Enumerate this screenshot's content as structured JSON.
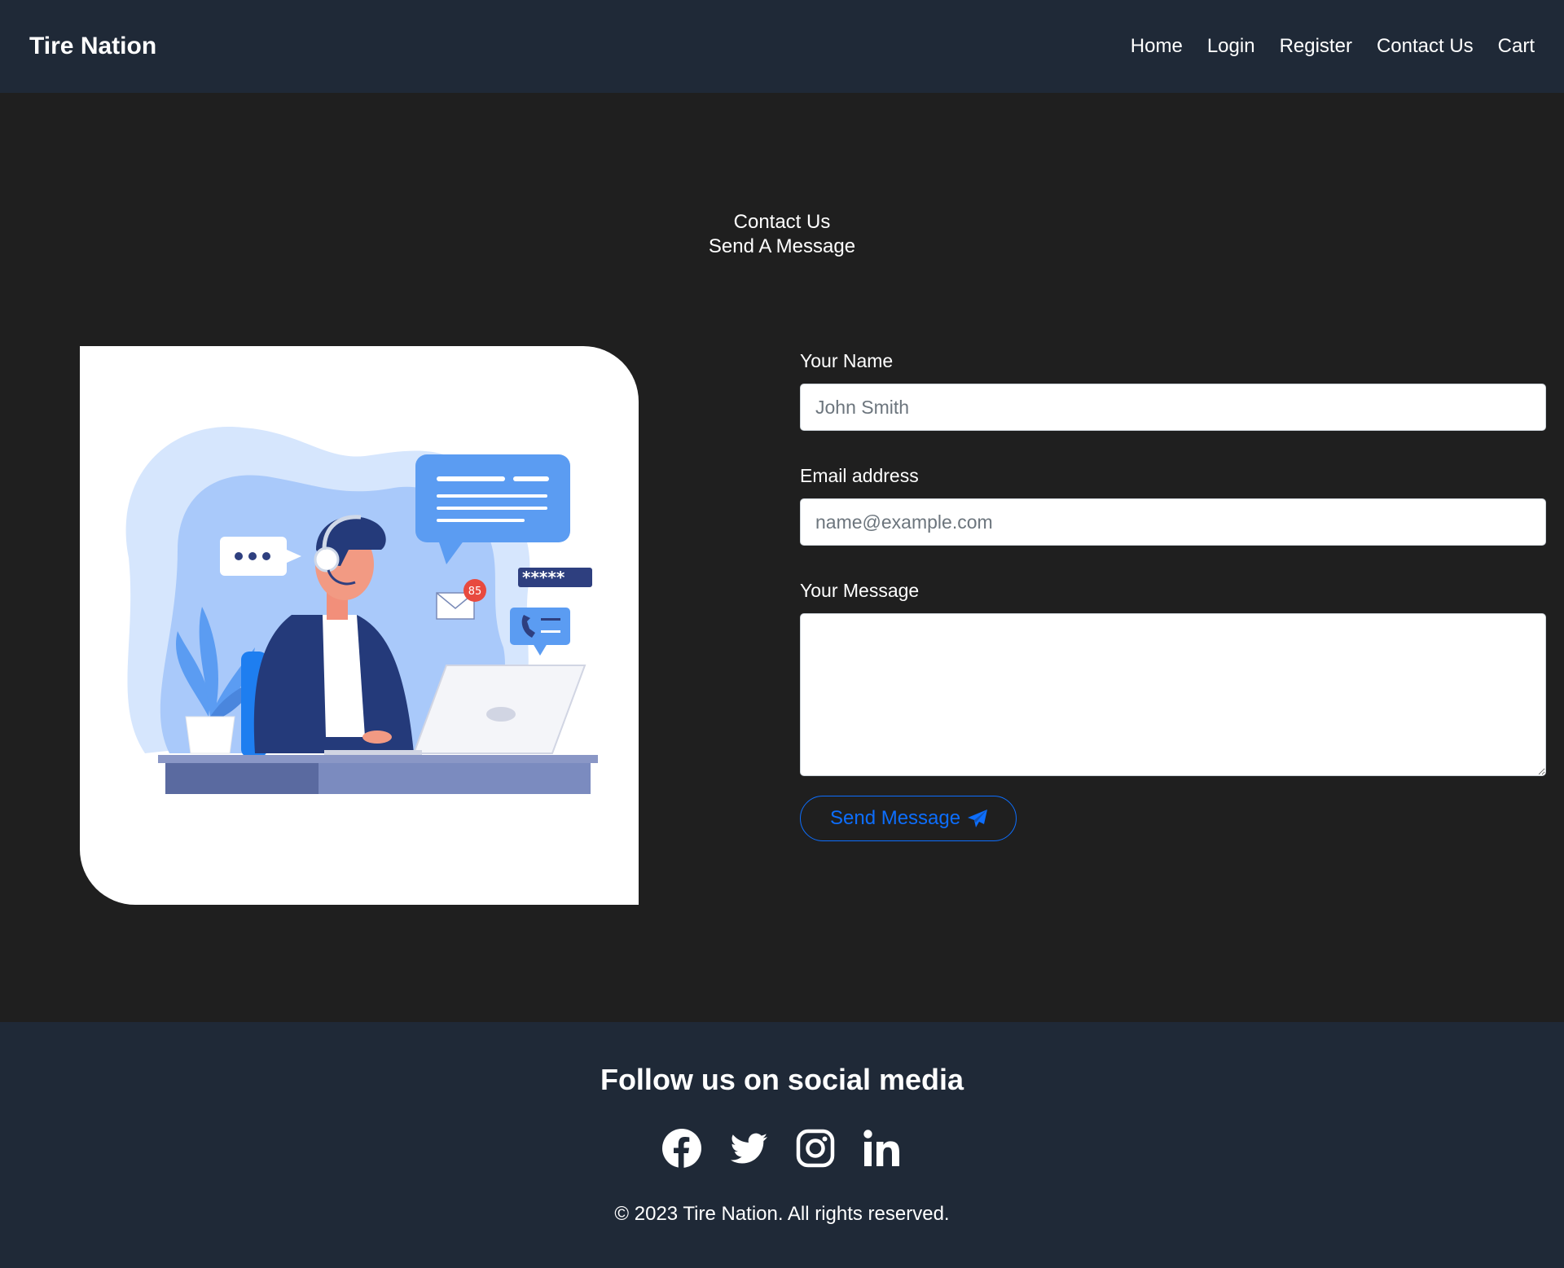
{
  "navbar": {
    "brand": "Tire Nation",
    "links": [
      "Home",
      "Login",
      "Register",
      "Contact Us",
      "Cart"
    ]
  },
  "header": {
    "title": "Contact Us",
    "subtitle": "Send A Message"
  },
  "illustration": {
    "badge_count": "85",
    "password_mask": "*****"
  },
  "form": {
    "name_label": "Your Name",
    "name_placeholder": "John Smith",
    "email_label": "Email address",
    "email_placeholder": "name@example.com",
    "message_label": "Your Message",
    "message_value": "",
    "send_label": "Send Message"
  },
  "footer": {
    "heading": "Follow us on social media",
    "social": [
      "facebook-icon",
      "twitter-icon",
      "instagram-icon",
      "linkedin-icon"
    ],
    "copyright": "© 2023 Tire Nation. All rights reserved."
  },
  "colors": {
    "navbar_bg": "#1f2937",
    "page_bg": "#1f1f1f",
    "accent": "#0d6efd"
  }
}
